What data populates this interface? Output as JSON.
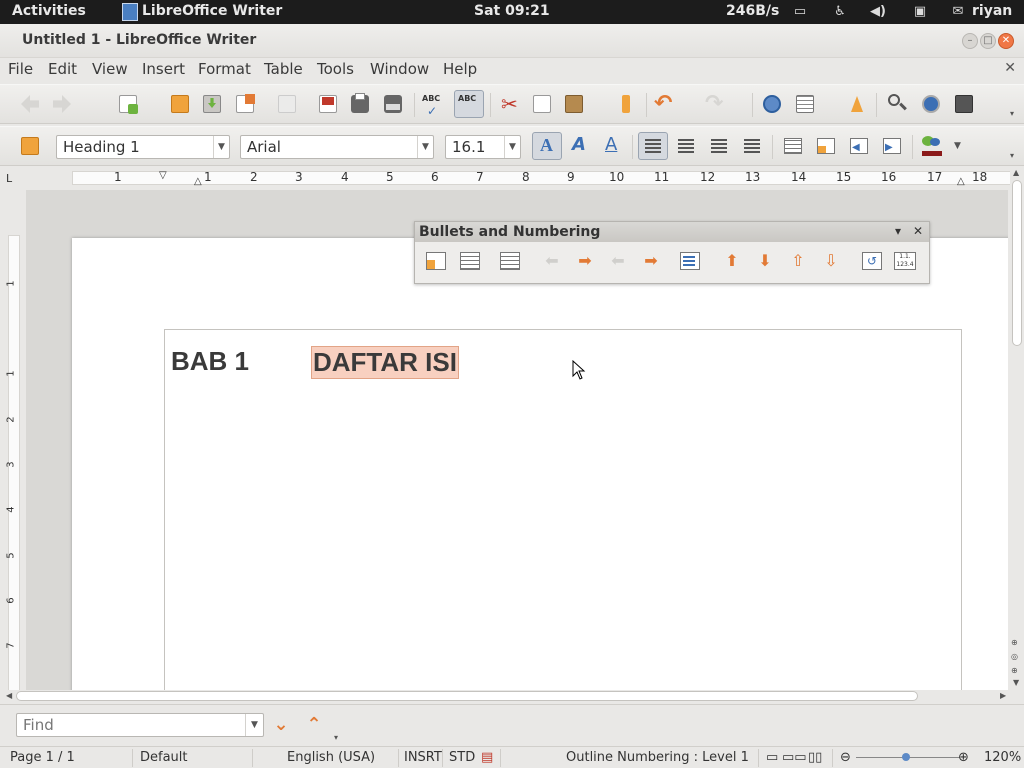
{
  "topbar": {
    "activities": "Activities",
    "app_name": "LibreOffice Writer",
    "clock": "Sat 09:21",
    "network_speed": "246B/s",
    "user": "riyan"
  },
  "window": {
    "title": "Untitled 1 - LibreOffice Writer"
  },
  "menu": {
    "file": "File",
    "edit": "Edit",
    "view": "View",
    "insert": "Insert",
    "format": "Format",
    "table": "Table",
    "tools": "Tools",
    "window": "Window",
    "help": "Help"
  },
  "formatting": {
    "paragraph_style": "Heading 1",
    "font_name": "Arial",
    "font_size": "16.1"
  },
  "ruler": {
    "h_numbers": [
      "1",
      "1",
      "2",
      "3",
      "4",
      "5",
      "6",
      "7",
      "8",
      "9",
      "10",
      "11",
      "12",
      "13",
      "14",
      "15",
      "16",
      "17",
      "18"
    ],
    "v_numbers": [
      "1",
      "1",
      "2",
      "3",
      "4",
      "5",
      "6",
      "7"
    ]
  },
  "bullets_panel": {
    "title": "Bullets and Numbering"
  },
  "document": {
    "heading_number": "BAB 1",
    "heading_text": "DAFTAR ISI"
  },
  "find": {
    "placeholder": "Find"
  },
  "status": {
    "page": "Page 1 / 1",
    "page_style": "Default",
    "language": "English (USA)",
    "insert_mode": "INSRT",
    "selection_mode": "STD",
    "outline": "Outline Numbering : Level 1",
    "zoom": "120%"
  },
  "colors": {
    "accent_orange": "#e27a35",
    "selection_bg": "#f8d0c0",
    "topbar_bg": "#1c1c1c",
    "close_button": "#f07746"
  },
  "icons": {
    "standard_toolbar": [
      "back-icon",
      "forward-icon",
      "new-document-icon",
      "open-icon",
      "save-icon",
      "send-mail-icon",
      "edit-file-icon",
      "export-pdf-icon",
      "print-icon",
      "print-preview-icon",
      "spellcheck-icon",
      "autospellcheck-icon",
      "cut-icon",
      "copy-icon",
      "paste-icon",
      "clone-formatting-icon",
      "undo-icon",
      "redo-icon",
      "hyperlink-icon",
      "table-icon",
      "draw-functions-icon",
      "find-replace-icon",
      "navigator-icon",
      "gallery-icon"
    ],
    "formatting_toolbar": [
      "styles-formatting-icon",
      "shadow-text-icon",
      "italic-effect-icon",
      "outline-font-icon",
      "align-left-icon",
      "align-center-icon",
      "align-right-icon",
      "justify-icon",
      "numbering-icon",
      "bullets-icon",
      "decrease-indent-icon",
      "increase-indent-icon",
      "highlight-color-icon"
    ]
  }
}
